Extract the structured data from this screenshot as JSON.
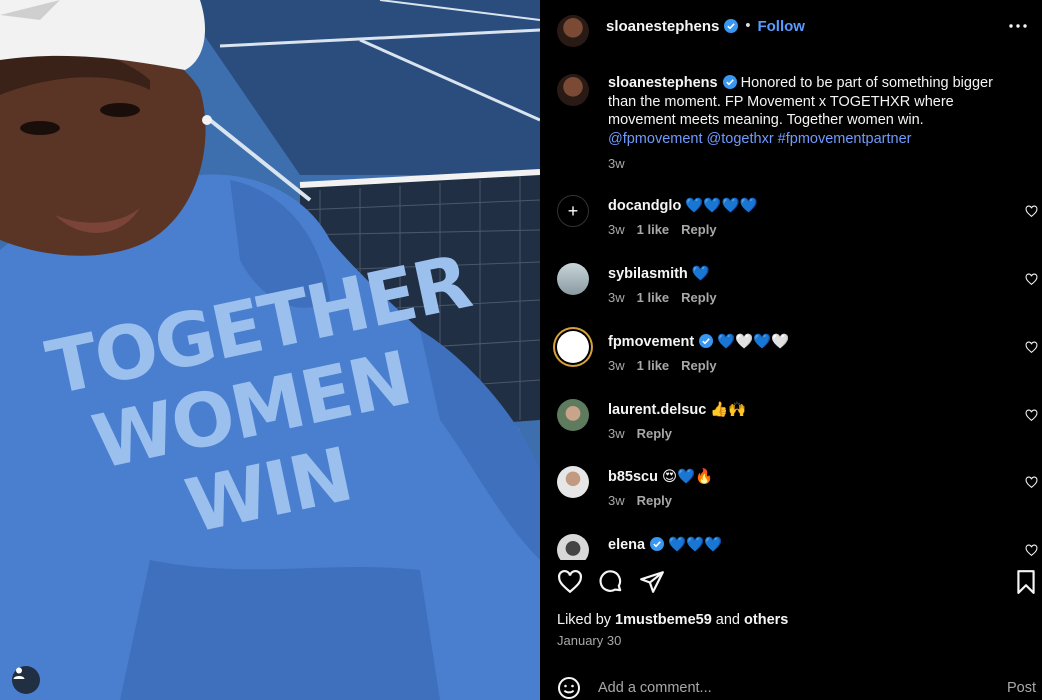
{
  "post": {
    "author": "sloanestephens",
    "follow_label": "Follow",
    "dot": "•",
    "photo_text": [
      "TOGETHER",
      "WOMEN",
      "WIN"
    ]
  },
  "caption": {
    "author": "sloanestephens",
    "text": "Honored to be part of something bigger than the moment. FP Movement x TOGETHXR where movement meets meaning. Together women win.",
    "tags": "@fpmovement @togethxr #fpmovementpartner",
    "time": "3w"
  },
  "comments": [
    {
      "user": "docandglo",
      "text": "💙💙💙💙",
      "time": "3w",
      "likes": "1 like",
      "reply": "Reply",
      "verified": false
    },
    {
      "user": "sybilasmith",
      "text": "💙",
      "time": "3w",
      "likes": "1 like",
      "reply": "Reply",
      "verified": false
    },
    {
      "user": "fpmovement",
      "text": "💙🤍💙🤍",
      "time": "3w",
      "likes": "1 like",
      "reply": "Reply",
      "verified": true
    },
    {
      "user": "laurent.delsuc",
      "text": "👍🙌",
      "time": "3w",
      "likes": "",
      "reply": "Reply",
      "verified": false
    },
    {
      "user": "b85scu",
      "text": "😍💙🔥",
      "time": "3w",
      "likes": "",
      "reply": "Reply",
      "verified": false
    },
    {
      "user": "elena",
      "text": "💙💙💙",
      "time": "",
      "likes": "",
      "reply": "",
      "verified": true
    }
  ],
  "likes": {
    "prefix": "Liked by",
    "user": "1mustbeme59",
    "and": "and",
    "others": "others"
  },
  "date": "January 30",
  "add_comment": {
    "placeholder": "Add a comment...",
    "post_label": "Post"
  },
  "colors": {
    "link": "#6f9bff",
    "follow": "#5a9bff",
    "verified": "#3897f0",
    "hoodie": "#4a7fd0"
  },
  "icons": {
    "more": "more-icon",
    "like": "heart-icon",
    "comment": "comment-icon",
    "share": "share-icon",
    "save": "bookmark-icon",
    "emoji": "emoji-icon",
    "user_tag": "user-tag-icon"
  }
}
